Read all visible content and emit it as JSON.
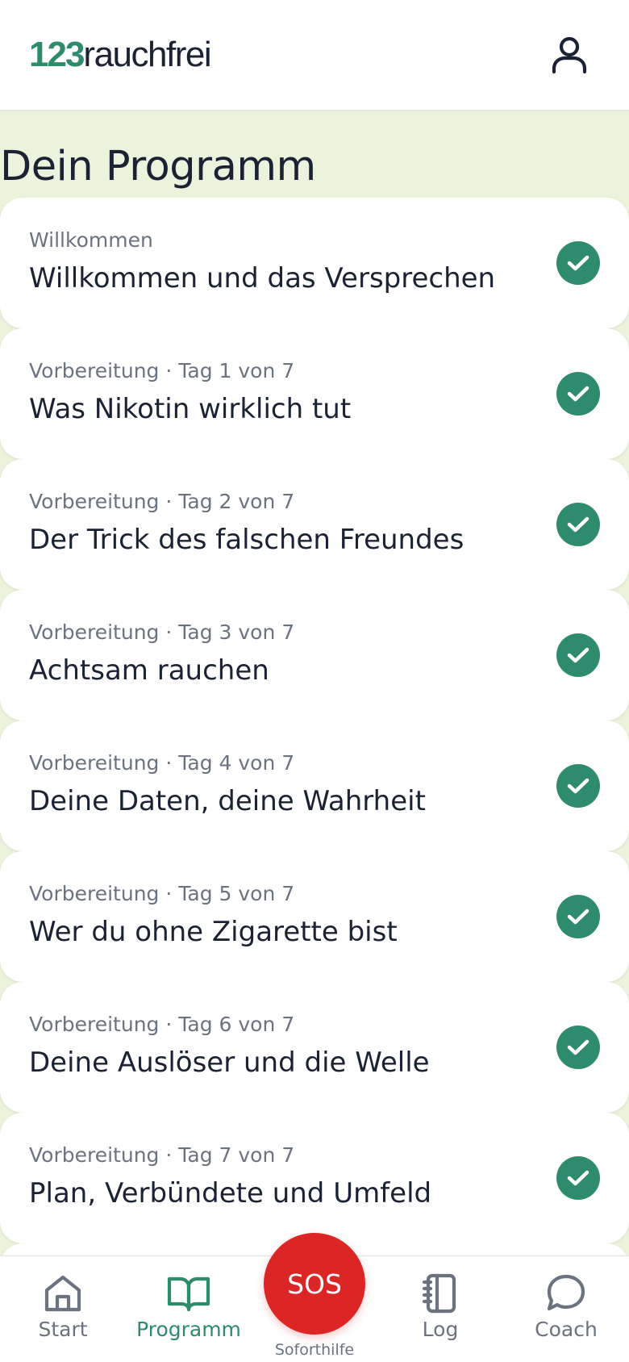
{
  "header": {
    "logo_number": "123",
    "logo_word": "rauchfrei",
    "profile_icon": "user-icon"
  },
  "page_title": "Dein Programm",
  "colors": {
    "accent": "#2e8b6e",
    "sos": "#dc2626",
    "background": "#ecf3dd",
    "text": "#1a2233",
    "muted": "#6b7280"
  },
  "modules": [
    {
      "kicker": "Willkommen",
      "title": "Willkommen und das Versprechen",
      "status": "completed",
      "status_icon": "check-circle-icon"
    },
    {
      "kicker": "Vorbereitung · Tag 1 von 7",
      "title": "Was Nikotin wirklich tut",
      "status": "completed",
      "status_icon": "check-circle-icon"
    },
    {
      "kicker": "Vorbereitung · Tag 2 von 7",
      "title": "Der Trick des falschen Freundes",
      "status": "completed",
      "status_icon": "check-circle-icon"
    },
    {
      "kicker": "Vorbereitung · Tag 3 von 7",
      "title": "Achtsam rauchen",
      "status": "completed",
      "status_icon": "check-circle-icon"
    },
    {
      "kicker": "Vorbereitung · Tag 4 von 7",
      "title": "Deine Daten, deine Wahrheit",
      "status": "completed",
      "status_icon": "check-circle-icon"
    },
    {
      "kicker": "Vorbereitung · Tag 5 von 7",
      "title": "Wer du ohne Zigarette bist",
      "status": "completed",
      "status_icon": "check-circle-icon"
    },
    {
      "kicker": "Vorbereitung · Tag 6 von 7",
      "title": "Deine Auslöser und die Welle",
      "status": "completed",
      "status_icon": "check-circle-icon"
    },
    {
      "kicker": "Vorbereitung · Tag 7 von 7",
      "title": "Plan, Verbündete und Umfeld",
      "status": "completed",
      "status_icon": "check-circle-icon"
    }
  ],
  "nav": {
    "start": {
      "label": "Start",
      "icon": "home-icon"
    },
    "programm": {
      "label": "Programm",
      "icon": "book-open-icon",
      "active": true
    },
    "sos": {
      "label": "SOS",
      "sublabel": "Soforthilfe"
    },
    "log": {
      "label": "Log",
      "icon": "notebook-icon"
    },
    "coach": {
      "label": "Coach",
      "icon": "chat-bubble-icon"
    }
  }
}
